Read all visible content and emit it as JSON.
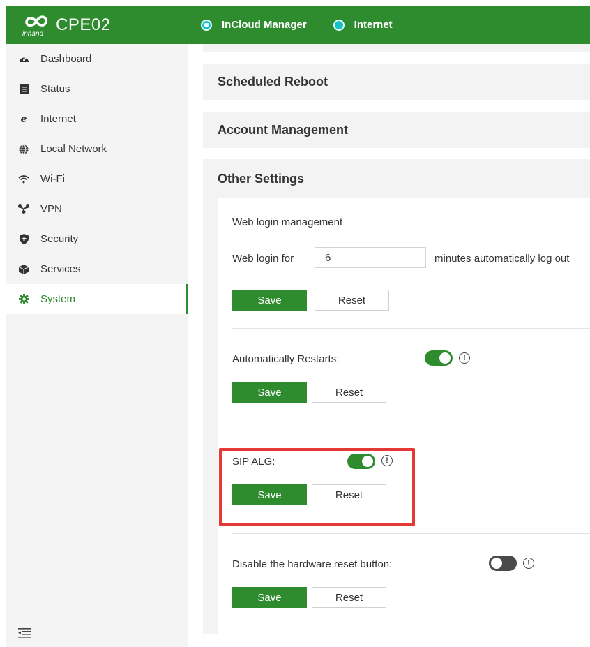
{
  "header": {
    "brand_sub": "inhand",
    "title": "CPE02",
    "chips": [
      {
        "label": "InCloud Manager",
        "icon": "cloud-icon"
      },
      {
        "label": "Internet",
        "icon": "status-dot-icon"
      }
    ]
  },
  "sidebar": {
    "items": [
      {
        "label": "Dashboard",
        "icon": "dashboard-icon"
      },
      {
        "label": "Status",
        "icon": "status-icon"
      },
      {
        "label": "Internet",
        "icon": "internet-icon"
      },
      {
        "label": "Local Network",
        "icon": "globe-icon"
      },
      {
        "label": "Wi-Fi",
        "icon": "wifi-icon"
      },
      {
        "label": "VPN",
        "icon": "vpn-icon"
      },
      {
        "label": "Security",
        "icon": "shield-icon"
      },
      {
        "label": "Services",
        "icon": "cube-icon"
      },
      {
        "label": "System",
        "icon": "gear-icon",
        "active": true
      }
    ]
  },
  "panels": {
    "scheduled_reboot": "Scheduled Reboot",
    "account_management": "Account Management",
    "other_settings": "Other Settings"
  },
  "other_settings": {
    "web_login": {
      "heading": "Web login management",
      "prefix": "Web login for",
      "value": "6",
      "suffix": "minutes automatically log out"
    },
    "auto_restart": {
      "label": "Automatically Restarts:",
      "enabled": true
    },
    "sip_alg": {
      "label": "SIP ALG:",
      "enabled": true
    },
    "hw_reset": {
      "label": "Disable the hardware reset button:",
      "enabled": false
    },
    "save_label": "Save",
    "reset_label": "Reset"
  },
  "colors": {
    "brand": "#2e8b2e",
    "highlight": "#e53935",
    "chip_dot": "#17c1c8"
  }
}
